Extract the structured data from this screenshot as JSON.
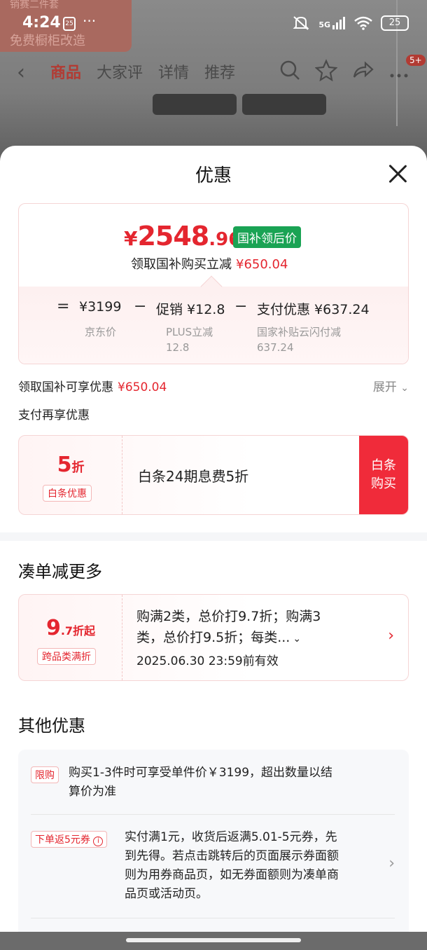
{
  "status_bar": {
    "time": "4:24",
    "calendar_badge": "25",
    "more": "···",
    "network": "5G",
    "battery": "25"
  },
  "background": {
    "promo_top": "销赛二件套",
    "promo_text": "免费橱柜改造"
  },
  "nav": {
    "tabs": [
      "商品",
      "大家评",
      "详情",
      "推荐"
    ],
    "cart_badge": "5+"
  },
  "sheet": {
    "title": "优惠"
  },
  "price_card": {
    "yen": "¥",
    "final_int": "2548",
    "final_dec": ".96",
    "final_tag": "国补领后价",
    "subsidy_label": "领取国补购买立减",
    "subsidy_amount": "¥650.04",
    "equals": "=",
    "minus": "−",
    "jd_price": "¥3199",
    "jd_label": "京东价",
    "promo_value": "促销 ¥12.8",
    "promo_label_1": "PLUS立减",
    "promo_label_2": "12.8",
    "pay_value": "支付优惠 ¥637.24",
    "pay_label_1": "国家补贴云闪付减",
    "pay_label_2": "637.24"
  },
  "coupons": {
    "label": "领取国补可享优惠",
    "amount": "¥650.04",
    "expand": "展开",
    "pay_more": "支付再享优惠"
  },
  "baitiao": {
    "big": "5",
    "small": "折",
    "tag": "白条优惠",
    "desc": "白条24期息费5折",
    "button_line1": "白条",
    "button_line2": "购买"
  },
  "section_more": {
    "title": "凑单减更多"
  },
  "cross_category": {
    "big": "9",
    "small": ".7折起",
    "tag": "跨品类满折",
    "desc_line1": "购满2类，总价打9.7折；购满3",
    "desc_line2": "类，总价打9.5折；每类...",
    "date": "2025.06.30 23:59前有效"
  },
  "section_other": {
    "title": "其他优惠"
  },
  "other_offers": [
    {
      "tag": "限购",
      "text_line1": "购买1-3件时可享受单件价￥3199，超出数量以结",
      "text_line2": "算价为准"
    },
    {
      "tag": "下单返5元券",
      "text_line1": "实付满1元，收货后返满5.01-5元券，先",
      "text_line2": "到先得。若点击跳转后的页面展示券面额",
      "text_line3": "则为用券商品页，如无券面额则为凑单商",
      "text_line4": "品页或活动页。"
    }
  ],
  "colors": {
    "accent_red": "#e4262f",
    "tag_green": "#1aa354",
    "button_red": "#f02b3a"
  }
}
